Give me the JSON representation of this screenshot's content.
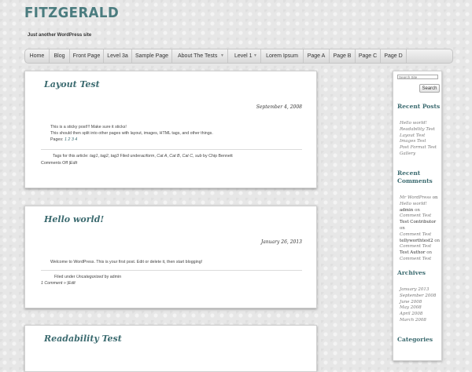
{
  "site": {
    "title": "FITZGERALD",
    "tagline": "Just another WordPress site"
  },
  "nav": {
    "items": [
      {
        "label": "Home"
      },
      {
        "label": "Blog"
      },
      {
        "label": "Front Page"
      },
      {
        "label": "Level 3a"
      },
      {
        "label": "Sample Page"
      },
      {
        "label": "About The Tests"
      },
      {
        "label": "Level 1"
      },
      {
        "label": "Lorem Ipsum"
      },
      {
        "label": "Page A"
      },
      {
        "label": "Page B"
      },
      {
        "label": "Page C"
      },
      {
        "label": "Page D"
      }
    ]
  },
  "posts": [
    {
      "title": "Layout Test",
      "date": "September 4, 2008",
      "body": [
        "This is a sticky post!!! Make sure it sticks!",
        "This should then split into other pages with layout, images, HTML tags, and other things."
      ],
      "pages_label": "Pages:",
      "pages": [
        "1",
        "2",
        "3",
        "4"
      ],
      "tags_prefix": "Tags for this article:",
      "tags": [
        "tag1",
        "tag2",
        "tag3"
      ],
      "filed_under_label": "Filed under",
      "categories": [
        "aciform",
        "Cat A",
        "Cat B",
        "Cat C",
        "sub"
      ],
      "author_prefix": "by",
      "author": "Chip Bennett",
      "comments": "Comments Off",
      "edit": "Edit"
    },
    {
      "title": "Hello world!",
      "date": "January 26, 2013",
      "body": [
        "Welcome to WordPress. This is your first post. Edit or delete it, then start blogging!"
      ],
      "filed_under_label": "Filed under",
      "category": "Uncategorized",
      "author_prefix": "by",
      "author": "admin",
      "comments": "1 Comment »",
      "edit": "Edit"
    },
    {
      "title": "Readability Test"
    }
  ],
  "sidebar": {
    "search_placeholder": "Search Site",
    "search_button": "Search",
    "recent_posts_title": "Recent Posts",
    "recent_posts": [
      "Hello world!",
      "Readability Test",
      "Layout Test",
      "Images Test",
      "Post Format Test",
      "Gallery"
    ],
    "recent_comments_title_1": "Recent",
    "recent_comments_title_2": "Comments",
    "recent_comments": [
      {
        "who": "Mr WordPress",
        "on": "on",
        "post": "Hello world!"
      },
      {
        "who": "admin",
        "on": "on",
        "post": "Comment Test"
      },
      {
        "who": "Test Contributor",
        "on": "on",
        "post": "Comment Test"
      },
      {
        "who": "tellyworthtest2",
        "on": "on",
        "post": "Comment Test"
      },
      {
        "who": "Test Author",
        "on": "on",
        "post": "Comment Test"
      }
    ],
    "archives_title": "Archives",
    "archives": [
      "January 2013",
      "September 2008",
      "June 2008",
      "May 2008",
      "April 2008",
      "March 2008"
    ],
    "categories_title": "Categories"
  }
}
